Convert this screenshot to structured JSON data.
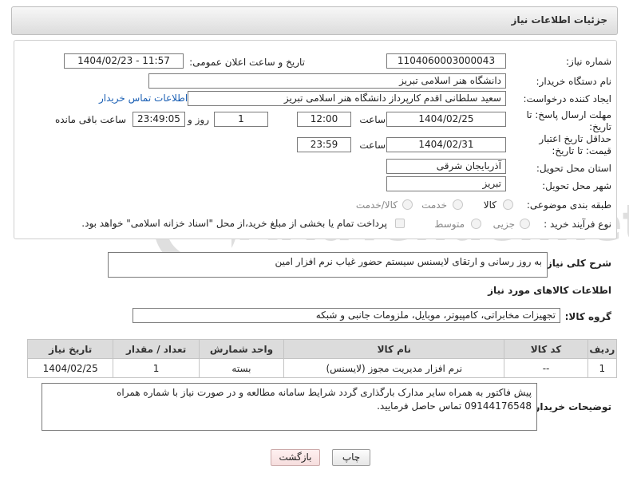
{
  "header": {
    "title": "جزئیات اطلاعات نیاز"
  },
  "form": {
    "need_number_label": "شماره نیاز:",
    "need_number": "1104060003000043",
    "announce_label": "تاریخ و ساعت اعلان عمومی:",
    "announce_value": "1404/02/23 - 11:57",
    "buyer_org_label": "نام دستگاه خریدار:",
    "buyer_org": "دانشگاه هنر اسلامی تبریز",
    "creator_label": "ایجاد کننده درخواست:",
    "creator": "سعید سلطانی اقدم کارپرداز دانشگاه هنر اسلامی تبریز",
    "buyer_contact_link": "اطلاعات تماس خریدار",
    "deadline_label": "مهلت ارسال پاسخ: تا تاریخ:",
    "deadline_date": "1404/02/25",
    "time_label": "ساعت",
    "deadline_time": "12:00",
    "days_value": "1",
    "days_label": "روز و",
    "remaining_time": "23:49:05",
    "remaining_label": "ساعت باقی مانده",
    "validity_label": "حداقل تاریخ اعتبار قیمت: تا تاریخ:",
    "validity_date": "1404/02/31",
    "validity_time": "23:59",
    "province_label": "استان محل تحویل:",
    "province": "آذربایجان شرقی",
    "city_label": "شهر محل تحویل:",
    "city": "تبریز",
    "category_label": "طبقه بندی موضوعی:",
    "category_options": [
      "کالا",
      "خدمت",
      "کالا/خدمت"
    ],
    "purchase_type_label": "نوع فرآیند خرید :",
    "purchase_options": [
      "جزیی",
      "متوسط"
    ],
    "payment_note": "پرداخت تمام یا بخشی از مبلغ خرید،از محل \"اسناد خزانه اسلامی\" خواهد بود."
  },
  "description": {
    "label": "شرح کلی نیاز:",
    "text": "به روز رسانی و ارتقای لایسنس سیستم حضور غیاب نرم افزار امین"
  },
  "goods": {
    "section_title": "اطلاعات کالاهای مورد نیاز",
    "group_label": "گروه کالا:",
    "group_value": "تجهیزات مخابراتی، کامپیوتر، موبایل، ملزومات جانبی و شبکه",
    "columns": [
      "ردیف",
      "کد کالا",
      "نام کالا",
      "واحد شمارش",
      "تعداد / مقدار",
      "تاریخ نیاز"
    ],
    "rows": [
      [
        "1",
        "--",
        "نرم افزار مدیریت مجوز (لایسنس)",
        "بسته",
        "1",
        "1404/02/25"
      ]
    ]
  },
  "buyer_notes": {
    "label": "توضیحات خریدار:",
    "text": "پیش فاکتور به همراه سایر مدارک بارگذاری گردد شرایط سامانه مطالعه و در صورت نیاز با شماره همراه 09144176548 تماس حاصل فرمایید."
  },
  "buttons": {
    "print": "چاپ",
    "back": "بازگشت"
  },
  "watermark": {
    "text": "AriaTender.net",
    "icon": "aria-logo-icon"
  }
}
